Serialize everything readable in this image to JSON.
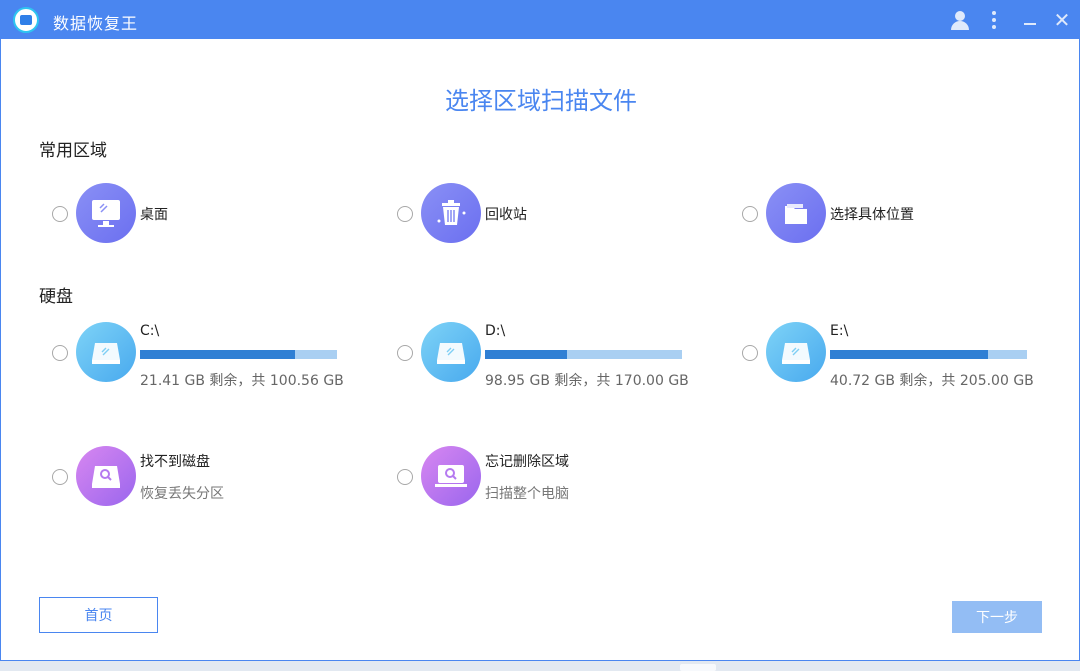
{
  "app": {
    "title": "数据恢复王"
  },
  "page": {
    "title": "选择区域扫描文件"
  },
  "sections": {
    "common": "常用区域",
    "disks": "硬盘"
  },
  "common_items": [
    {
      "label": "桌面",
      "icon": "desktop-icon"
    },
    {
      "label": "回收站",
      "icon": "recycle-bin-icon"
    },
    {
      "label": "选择具体位置",
      "icon": "folder-icon"
    }
  ],
  "drives": [
    {
      "name": "C:\\",
      "info": "21.41 GB 剩余，共 100.56 GB",
      "used_fraction": 0.787
    },
    {
      "name": "D:\\",
      "info": "98.95 GB 剩余，共 170.00 GB",
      "used_fraction": 0.418
    },
    {
      "name": "E:\\",
      "info": "40.72 GB 剩余，共 205.00 GB",
      "used_fraction": 0.801
    }
  ],
  "special_items": [
    {
      "title": "找不到磁盘",
      "desc": "恢复丢失分区"
    },
    {
      "title": "忘记删除区域",
      "desc": "扫描整个电脑"
    }
  ],
  "buttons": {
    "home": "首页",
    "next": "下一步"
  },
  "colors": {
    "accent": "#4a86f0",
    "drive_used": "#2f7fd4",
    "drive_free": "#a9cff2",
    "next_disabled": "#93bdf4"
  }
}
